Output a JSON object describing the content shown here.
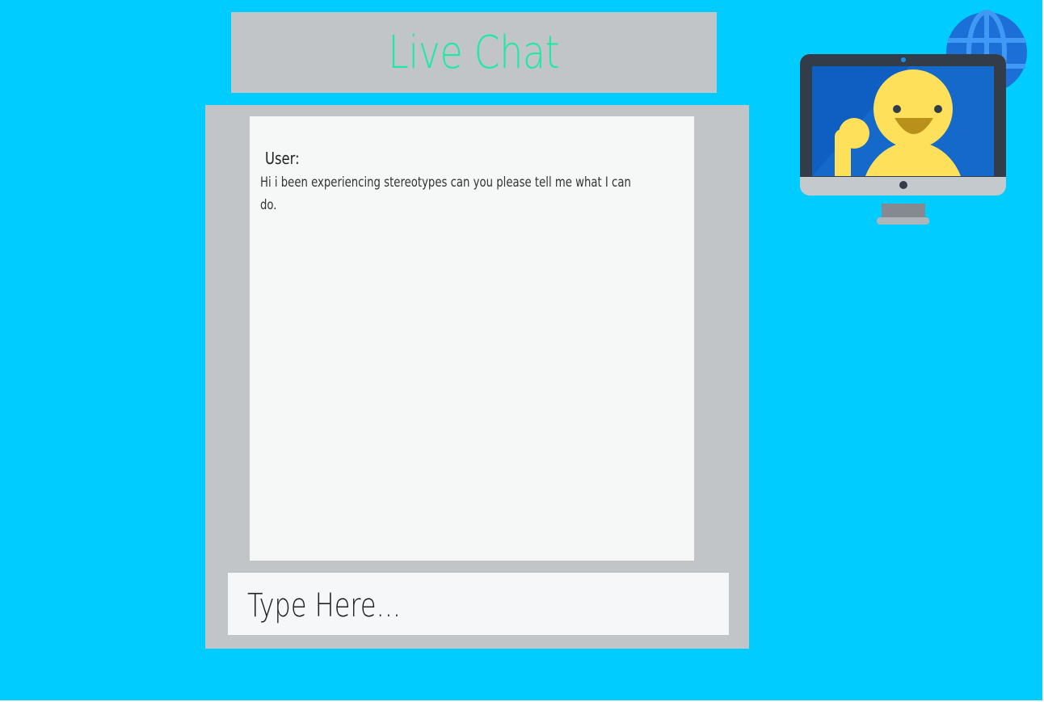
{
  "header": {
    "title": "Live Chat"
  },
  "chat": {
    "messages": [
      {
        "sender": "User:",
        "text": "Hi i been experiencing stereotypes can you please tell me what I can do."
      }
    ]
  },
  "composer": {
    "placeholder": "Type Here..."
  },
  "illustration": {
    "icons": [
      "globe-icon",
      "monitor-icon",
      "waving-person-icon"
    ]
  },
  "colors": {
    "background": "#00ccff",
    "panel": "#c1c5c8",
    "title_text": "#1de9a5",
    "message_area": "#f6f7f7"
  }
}
